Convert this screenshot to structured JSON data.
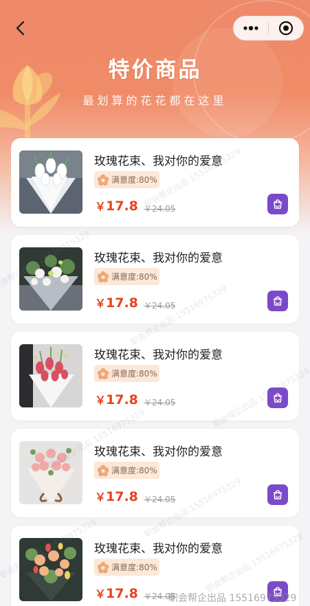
{
  "header": {
    "title": "特价商品",
    "subtitle": "最划算的花花都在这里"
  },
  "icons": {
    "back": "chevron-left-icon",
    "more": "more-dots-icon",
    "close": "target-circle-icon",
    "satisfaction": "flower-icon",
    "cart": "shopping-bag-icon"
  },
  "colors": {
    "header_gradient_top": "#ee8a6a",
    "price": "#e8431c",
    "tag_bg": "#fbe8d8",
    "cart_button": "#7b4ac9"
  },
  "products": [
    {
      "name": "玫瑰花束、我对你的爱意",
      "satisfaction": "满意度:80%",
      "currency": "￥",
      "price": "17.8",
      "original_price": "￥24.05"
    },
    {
      "name": "玫瑰花束、我对你的爱意",
      "satisfaction": "满意度:80%",
      "currency": "￥",
      "price": "17.8",
      "original_price": "￥24.05"
    },
    {
      "name": "玫瑰花束、我对你的爱意",
      "satisfaction": "满意度:80%",
      "currency": "￥",
      "price": "17.8",
      "original_price": "￥24.05"
    },
    {
      "name": "玫瑰花束、我对你的爱意",
      "satisfaction": "满意度:80%",
      "currency": "￥",
      "price": "17.8",
      "original_price": "￥24.05"
    },
    {
      "name": "玫瑰花束、我对你的爱意",
      "satisfaction": "满意度:80%",
      "currency": "￥",
      "price": "17.8",
      "original_price": "￥24.05"
    }
  ],
  "watermark": {
    "text": "职会帮企出品 15516975329",
    "footer": "职会帮企出品 15516975329"
  }
}
